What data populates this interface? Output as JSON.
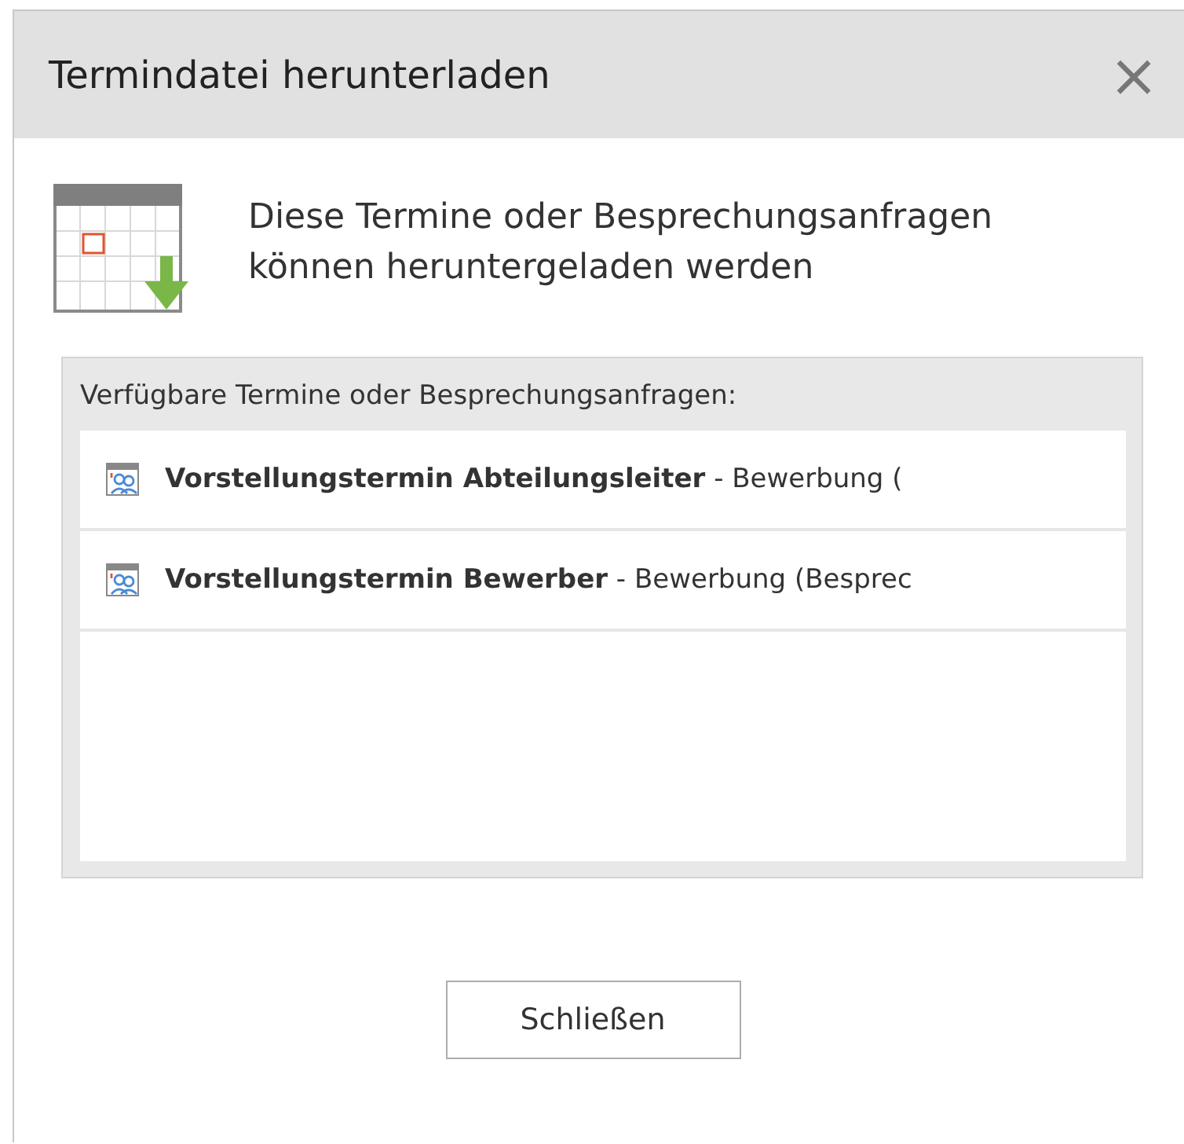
{
  "window": {
    "title": "Termindatei herunterladen",
    "close": "×"
  },
  "message": "Diese Termine oder Besprechungsanfragen können heruntergeladen werden",
  "list": {
    "label": "Verfügbare Termine oder Besprechungsanfragen:",
    "items": [
      {
        "text": "**Vorstellungstermin Abteilungsleiter** - Bewerbung (",
        "selected": false
      },
      {
        "text": "**Vorstellungstermin Bewerber** - Bewerbung (Besprec",
        "selected": false
      }
    ]
  },
  "buttons": [
    "Schließen"
  ]
}
